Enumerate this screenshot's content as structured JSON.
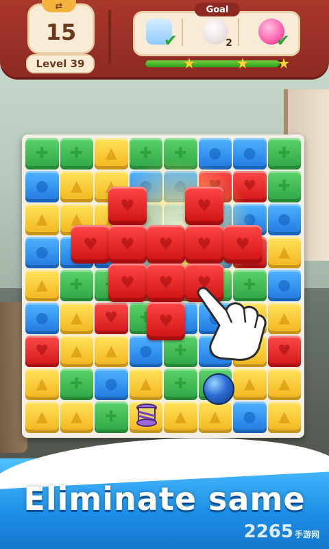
{
  "header": {
    "moves": "15",
    "level": "Level 39",
    "goal_title": "Goal",
    "goals": [
      {
        "item": "pillow",
        "color": "#9ed3ff",
        "count": "",
        "done": true
      },
      {
        "item": "bubble",
        "color": "#f4ecec",
        "count": "2",
        "done": false
      },
      {
        "item": "balloon",
        "color": "#ff6fb6",
        "count": "",
        "done": true
      }
    ],
    "progress_fraction": 0.95,
    "stars": 3
  },
  "board": {
    "rows": [
      [
        "green",
        "green",
        "yellow",
        "green",
        "green",
        "blue",
        "blue",
        "green"
      ],
      [
        "blue",
        "yellow",
        "yellow",
        "blue",
        "blue",
        "red",
        "red",
        "green"
      ],
      [
        "yellow",
        "yellow",
        "yellow",
        "blue",
        "blue",
        "blue",
        "blue",
        "blue"
      ],
      [
        "blue",
        "blue",
        "blue",
        "blue",
        "yellow",
        "blue",
        "red",
        "yellow"
      ],
      [
        "yellow",
        "green",
        "green",
        "green",
        "green",
        "green",
        "green",
        "blue"
      ],
      [
        "blue",
        "yellow",
        "red",
        "green",
        "blue",
        "blue",
        "yellow",
        "yellow"
      ],
      [
        "red",
        "yellow",
        "yellow",
        "blue",
        "green",
        "blue",
        "yellow",
        "red"
      ],
      [
        "yellow",
        "green",
        "blue",
        "yellow",
        "green",
        "green",
        "yellow",
        "yellow"
      ],
      [
        "yellow",
        "yellow",
        "green",
        "yellow",
        "yellow",
        "yellow",
        "blue",
        "yellow"
      ]
    ],
    "glyphs": {
      "green": "✚",
      "blue": "●",
      "yellow": "▲",
      "red": "♥"
    }
  },
  "banner": {
    "text": "Eliminate same",
    "watermark": "2265",
    "watermark_suffix": "手游网"
  }
}
